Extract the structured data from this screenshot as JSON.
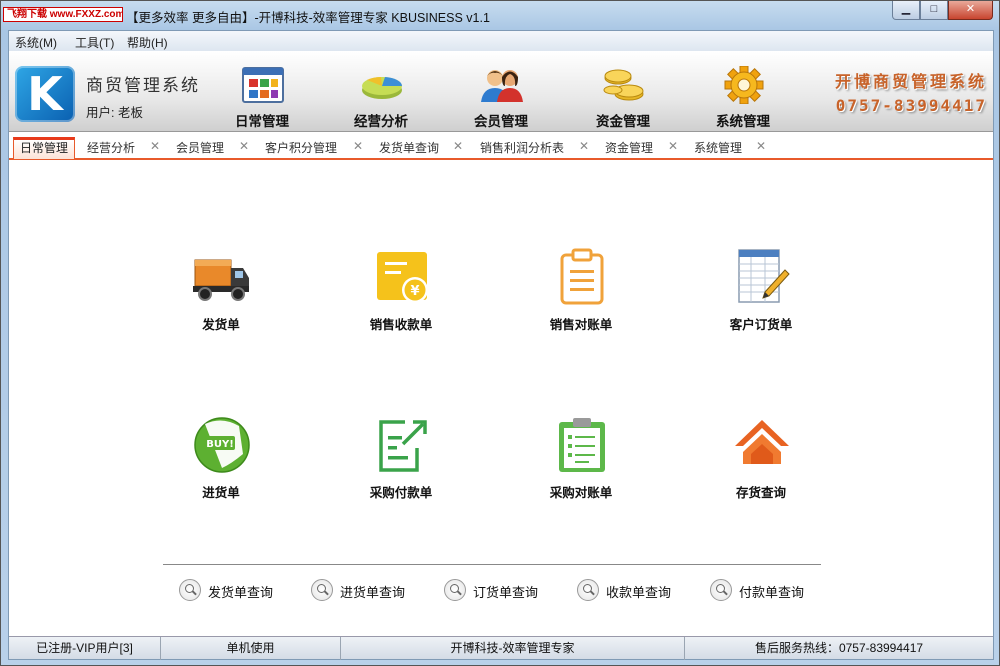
{
  "window": {
    "watermark": "飞翔下载 www.FXXZ.com",
    "title": "【更多效率 更多自由】-开博科技-效率管理专家  KBUSINESS v1.1",
    "min_label": "▁",
    "max_label": "□",
    "close_label": "✕"
  },
  "menu": {
    "items": [
      {
        "label": "系统(M)"
      },
      {
        "label": "工具(T)"
      },
      {
        "label": "帮助(H)"
      }
    ]
  },
  "header": {
    "logo_letter": "K",
    "system_name": "商贸管理系统",
    "user_label": "用户: 老板",
    "nav": [
      {
        "label": "日常管理",
        "icon": "calendar-grid-icon"
      },
      {
        "label": "经营分析",
        "icon": "pie-chart-icon"
      },
      {
        "label": "会员管理",
        "icon": "members-icon"
      },
      {
        "label": "资金管理",
        "icon": "coins-icon"
      },
      {
        "label": "系统管理",
        "icon": "gear-icon"
      }
    ],
    "brand_name": "开博商贸管理系统",
    "brand_phone": "0757-83994417"
  },
  "tabs": [
    {
      "label": "日常管理",
      "active": true
    },
    {
      "label": "经营分析"
    },
    {
      "label": "会员管理"
    },
    {
      "label": "客户积分管理"
    },
    {
      "label": "发货单查询"
    },
    {
      "label": "销售利润分析表"
    },
    {
      "label": "资金管理"
    },
    {
      "label": "系统管理"
    }
  ],
  "tab_close": "✕",
  "tiles": [
    {
      "label": "发货单",
      "icon": "truck-icon"
    },
    {
      "label": "销售收款单",
      "icon": "receipt-yen-icon"
    },
    {
      "label": "销售对账单",
      "icon": "clipboard-icon"
    },
    {
      "label": "客户订货单",
      "icon": "spreadsheet-pencil-icon"
    },
    {
      "label": "进货单",
      "icon": "buy-sticker-icon"
    },
    {
      "label": "采购付款单",
      "icon": "document-arrow-icon"
    },
    {
      "label": "采购对账单",
      "icon": "checklist-clipboard-icon"
    },
    {
      "label": "存货查询",
      "icon": "house-icon"
    }
  ],
  "buy_text": "BUY!",
  "yen_text": "¥",
  "quick_links": [
    {
      "label": "发货单查询"
    },
    {
      "label": "进货单查询"
    },
    {
      "label": "订货单查询"
    },
    {
      "label": "收款单查询"
    },
    {
      "label": "付款单查询"
    }
  ],
  "status": {
    "registered": "已注册-VIP用户[3]",
    "mode": "单机使用",
    "company": "开博科技-效率管理专家",
    "hotline": "售后服务热线：0757-83994417"
  }
}
